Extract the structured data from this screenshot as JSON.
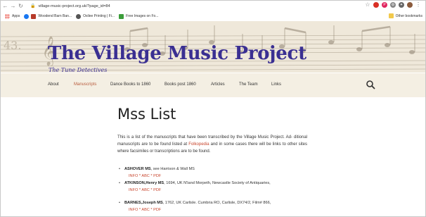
{
  "browser": {
    "url": "village-music-project.org.uk/?page_id=84",
    "bookmarks": [
      "Apps",
      "Woodend Barn Ban...",
      "Oxilee Printing | Fi...",
      "Free Images on Fo..."
    ],
    "other_bookmarks": "Other bookmarks"
  },
  "site": {
    "title": "The Village Music Project",
    "tagline": "The Tune Detectives"
  },
  "nav": {
    "items": [
      "About",
      "Manuscripts",
      "Dance Books to 1860",
      "Books post 1860",
      "Articles",
      "The Team",
      "Links"
    ],
    "active": "Manuscripts"
  },
  "page": {
    "title": "Mss List",
    "intro_1": "This is a list of the manuscripts that have been transcribed by the Village Music Project. Ad- ditional manuscripts are to be found listed at ",
    "intro_link": "Folkopedia",
    "intro_2": " and in some cases there will be links to other sites where facsimiles or transcriptions are to be found."
  },
  "entries": [
    {
      "name": "ASHOVER MS",
      "details": ", see Harrison & Wall MS",
      "links": "INFO * ABC * PDF"
    },
    {
      "name": "ATKINSON,Henry MS",
      "details": ", 1694, UK N'land Morpeth, Newcastle Society of Antiquaries,",
      "links": "INFO * ABC * PDF"
    },
    {
      "name": "BARNES,Joseph MS",
      "details": ", 1762, UK Carlisle. Cumbria RO, Carlisle, DX74/2, Film# 866,",
      "links": "INFO * ABC * PDF"
    }
  ]
}
